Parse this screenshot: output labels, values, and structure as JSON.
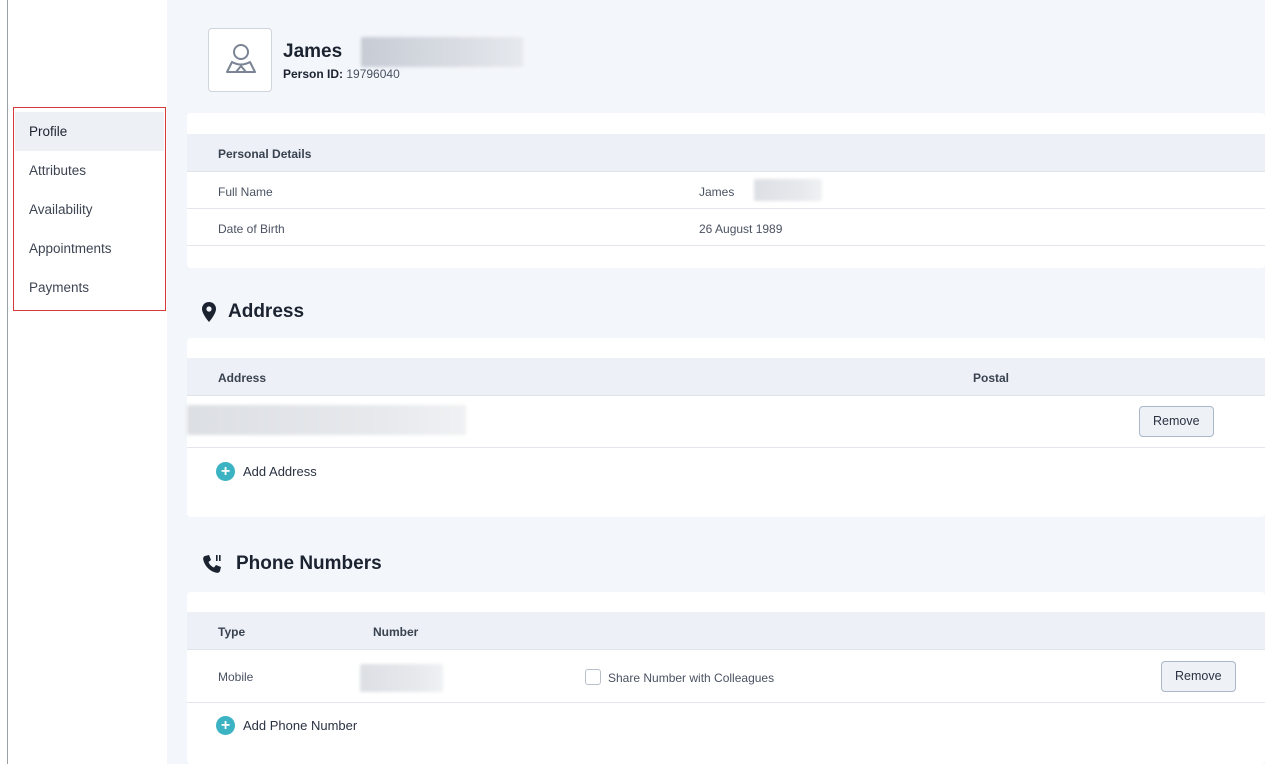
{
  "sidebar": {
    "items": [
      {
        "label": "Profile",
        "active": true
      },
      {
        "label": "Attributes"
      },
      {
        "label": "Availability"
      },
      {
        "label": "Appointments"
      },
      {
        "label": "Payments"
      }
    ],
    "highlight_color": "#d63b3b"
  },
  "person": {
    "first_name": "James",
    "id_label": "Person ID:",
    "id_value": "19796040",
    "avatar_icon": "user-avatar-icon"
  },
  "personal_details": {
    "header": "Personal Details",
    "rows": [
      {
        "label": "Full Name",
        "value": "James"
      },
      {
        "label": "Date of Birth",
        "value": "26 August 1989"
      }
    ]
  },
  "address": {
    "title": "Address",
    "icon": "map-pin-icon",
    "columns": [
      "Address",
      "Postal"
    ],
    "remove_label": "Remove",
    "add_label": "Add Address"
  },
  "phone": {
    "title": "Phone Numbers",
    "icon": "phone-icon",
    "columns": [
      "Type",
      "Number"
    ],
    "rows": [
      {
        "type": "Mobile",
        "share_label": "Share Number with Colleagues",
        "remove_label": "Remove"
      }
    ],
    "add_label": "Add Phone Number"
  },
  "colors": {
    "accent": "#3bb3c3",
    "page_bg": "#f3f6fa",
    "table_header_bg": "#edf1f7"
  }
}
